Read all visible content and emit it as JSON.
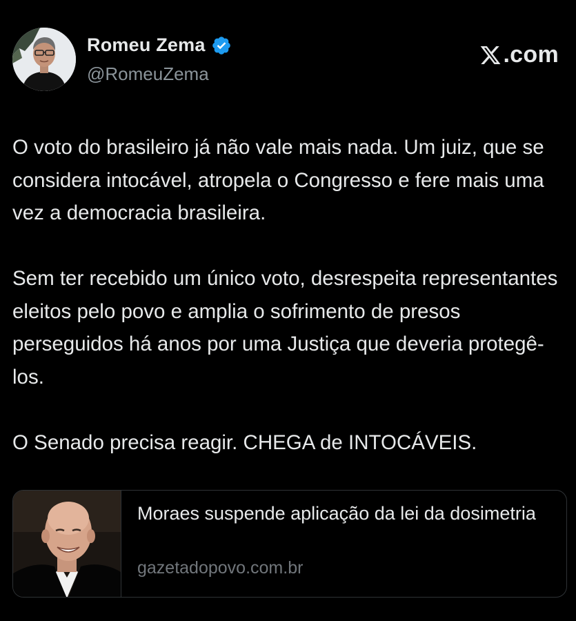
{
  "author": {
    "display_name": "Romeu Zema",
    "handle": "@RomeuZema",
    "verified_icon": "verified-badge-icon",
    "avatar": "profile-photo"
  },
  "brand": {
    "icon": "x-logo-icon",
    "domain": ".com"
  },
  "tweet": {
    "paragraphs": [
      "O voto do brasileiro já não vale mais nada. Um juiz, que se considera intocável, atropela o Congresso e fere mais uma vez a democracia brasileira.",
      "Sem ter recebido um único voto, desrespeita representantes eleitos pelo povo e amplia o sofrimento de presos perseguidos há anos por uma Justiça que deveria protegê-los.",
      "O Senado precisa reagir. CHEGA de INTOCÁVEIS."
    ]
  },
  "link_card": {
    "title": "Moraes suspende aplicação da lei da dosimetria",
    "domain": "gazetadopovo.com.br",
    "thumbnail": "article-photo"
  },
  "colors": {
    "background": "#000000",
    "text_primary": "#e7e9ea",
    "text_secondary": "#71767b",
    "verified_blue": "#1d9bf0",
    "card_border": "#2f3336"
  }
}
